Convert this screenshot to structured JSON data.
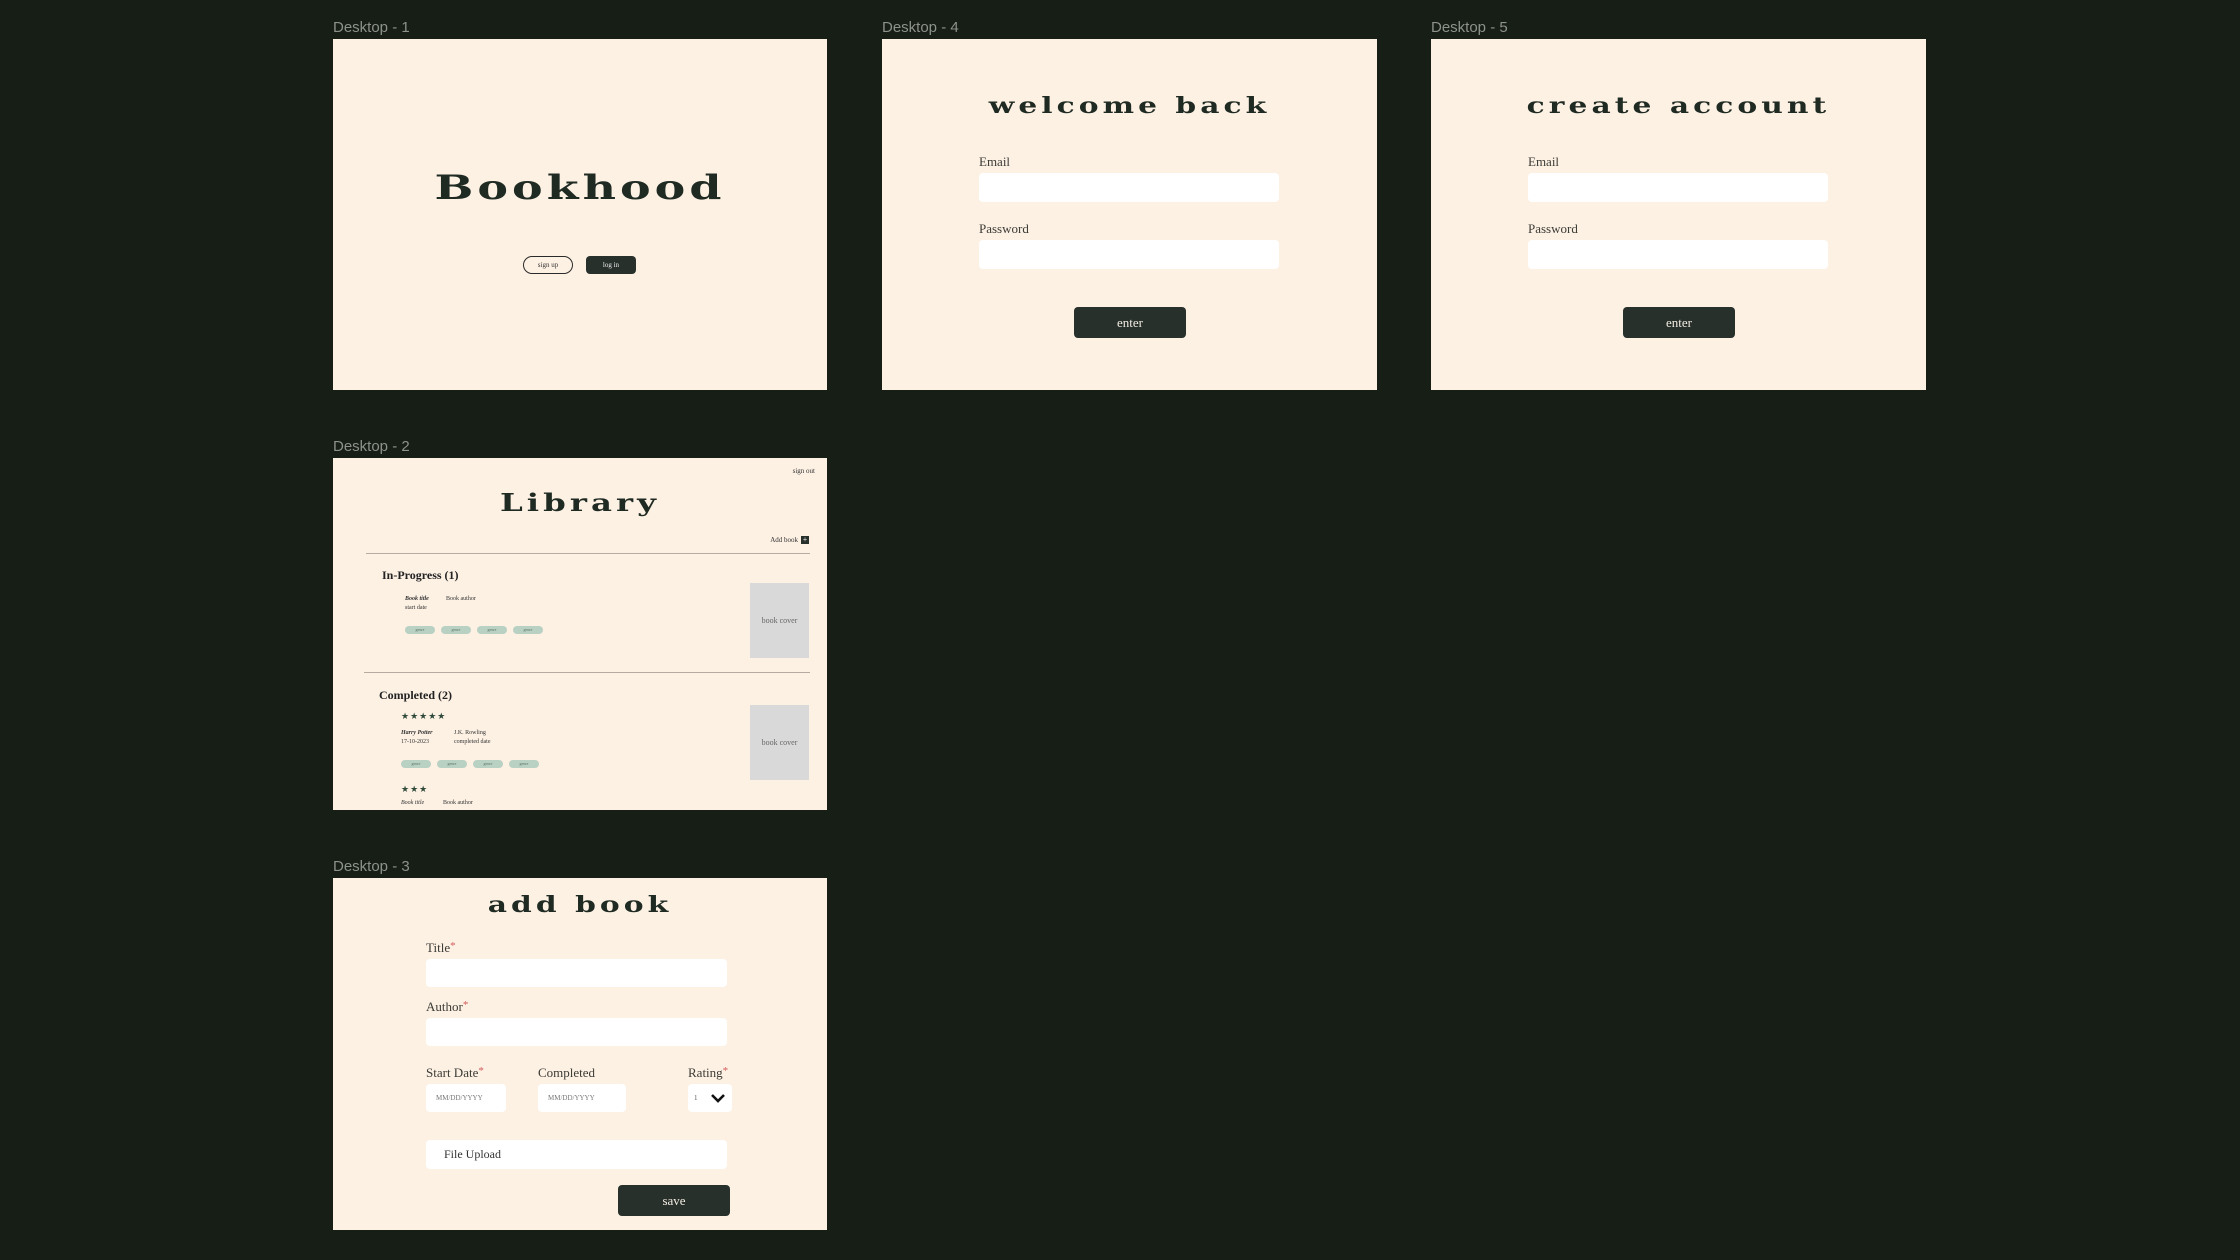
{
  "frames": {
    "landing": {
      "label": "Desktop - 1",
      "title": "Bookhood",
      "signup_label": "sign up",
      "login_label": "log in"
    },
    "login": {
      "label": "Desktop - 4",
      "title": "welcome back",
      "email_label": "Email",
      "password_label": "Password",
      "enter_label": "enter"
    },
    "signup": {
      "label": "Desktop - 5",
      "title": "create account",
      "email_label": "Email",
      "password_label": "Password",
      "enter_label": "enter"
    },
    "library": {
      "label": "Desktop - 2",
      "signout_label": "sign out",
      "title": "Library",
      "add_book_label": "Add book",
      "in_progress": {
        "heading": "In-Progress (1)",
        "book_title": "Book title",
        "book_author": "Book author",
        "start_date": "start date",
        "genres": [
          "genre",
          "genre",
          "genre",
          "genre"
        ],
        "cover_label": "book cover"
      },
      "completed": {
        "heading": "Completed (2)",
        "book1": {
          "stars": "★★★★★",
          "rating": 5,
          "title": "Harry Potter",
          "author": "J.K. Rowling",
          "start": "17-10-2023",
          "completed": "completed date",
          "genres": [
            "genre",
            "genre",
            "genre",
            "genre"
          ],
          "cover_label": "book cover"
        },
        "book2": {
          "stars": "★★★",
          "rating": 3,
          "title": "Book title",
          "author": "Book author"
        }
      }
    },
    "add_book": {
      "label": "Desktop - 3",
      "title": "add book",
      "title_label": "Title",
      "author_label": "Author",
      "start_label": "Start Date",
      "completed_label": "Completed",
      "rating_label": "Rating",
      "required_mark": "*",
      "date_placeholder": "MM/DD/YYYY",
      "rating_value": "1",
      "file_upload_label": "File Upload",
      "save_label": "save"
    }
  },
  "colors": {
    "canvas": "#171e15",
    "frame_bg": "#fdf1e4",
    "dark_button": "#27302b",
    "genre_pill": "#b9d1c3",
    "required": "#d25a5a"
  }
}
